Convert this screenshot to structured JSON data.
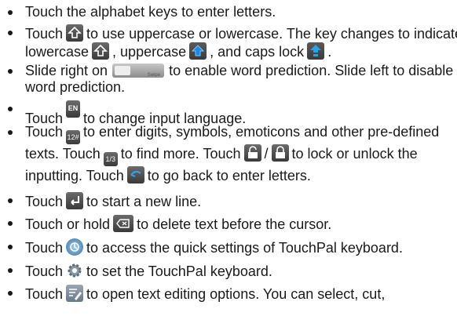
{
  "items": [
    {
      "t1": "Touch the alphabet keys to enter letters."
    },
    {
      "t1": "Touch",
      "t2": "to use uppercase or lowercase. The key changes to indicate lowercase",
      "t3": ", uppercase",
      "t4": ", and caps lock",
      "t5": "."
    },
    {
      "t1": "Slide right on",
      "t2": "to enable word prediction. Slide left to disable word prediction."
    },
    {
      "t1": "Touch",
      "t2": "to change input language."
    },
    {
      "t1": "Touch",
      "t2": "to enter digits, symbols, emoticons and other pre-defined texts. Touch",
      "t3": "to find more. Touch",
      "t4": "/",
      "t5": "to lock or unlock the inputting. Touch",
      "t6": "to go back to enter letters."
    },
    {
      "t1": "Touch",
      "t2": "to start a new line."
    },
    {
      "t1": "Touch or hold",
      "t2": "to delete text before the cursor."
    },
    {
      "t1": "Touch",
      "t2": "to access the quick settings of TouchPal keyboard."
    },
    {
      "t1": "Touch",
      "t2": "to set the TouchPal keyboard."
    },
    {
      "t1": "Touch",
      "t2": "to open text editing options. You can select, cut,"
    }
  ],
  "keys": {
    "lang": "EN",
    "digits": "12#",
    "page": "1/3",
    "slider_label": "Swipe"
  },
  "colors": {
    "key_gray": "#4a4a4a",
    "upper_blue": "#1e88e5",
    "caps_blue": "#29a3e8"
  }
}
